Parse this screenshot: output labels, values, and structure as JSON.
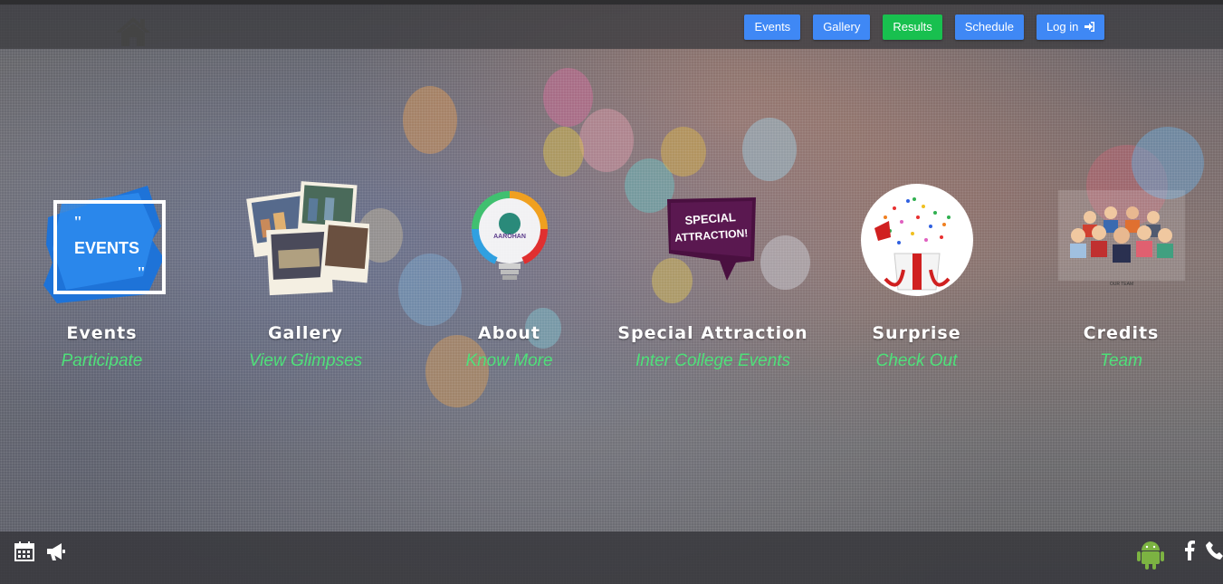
{
  "nav": {
    "home_icon": "home-icon",
    "buttons": [
      {
        "label": "Events",
        "color": "#3f88f5"
      },
      {
        "label": "Gallery",
        "color": "#3f88f5"
      },
      {
        "label": "Results",
        "color": "#18c04f"
      },
      {
        "label": "Schedule",
        "color": "#3f88f5"
      },
      {
        "label": "Log in",
        "icon": "sign-in-icon",
        "color": "#3f88f5"
      }
    ]
  },
  "tiles": [
    {
      "title": "Events",
      "subtitle": "Participate",
      "image_text": "EVENTS",
      "icon": "events-brush-image"
    },
    {
      "title": "Gallery",
      "subtitle": "View Glimpses",
      "icon": "polaroid-photos-image"
    },
    {
      "title": "About",
      "subtitle": "Know More",
      "image_text": "AAROHAN",
      "icon": "lightbulb-logo-image"
    },
    {
      "title": "Special Attraction",
      "subtitle": "Inter College Events",
      "image_text": "SPECIAL ATTRACTION!",
      "icon": "special-attraction-banner-image"
    },
    {
      "title": "Surprise",
      "subtitle": "Check Out",
      "icon": "gift-box-confetti-image"
    },
    {
      "title": "Credits",
      "subtitle": "Team",
      "image_text": "OUR TEAM",
      "icon": "team-people-image"
    }
  ],
  "footer": {
    "left_icons": [
      "calendar-icon",
      "megaphone-icon"
    ],
    "right_icons": [
      "android-icon",
      "facebook-icon",
      "phone-icon"
    ]
  },
  "colors": {
    "accent_blue": "#3f88f5",
    "accent_green": "#18c04f",
    "subtitle_green": "#4fe07a"
  }
}
